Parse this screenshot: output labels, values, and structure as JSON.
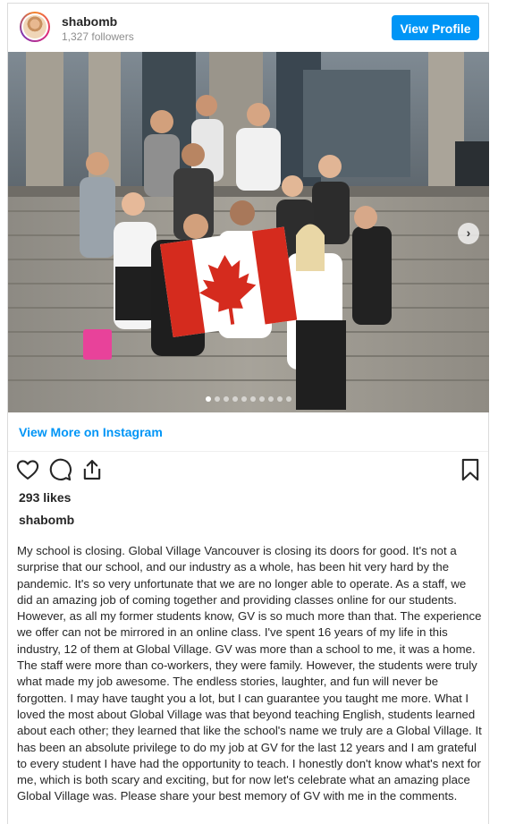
{
  "post": {
    "username": "shabomb",
    "followers": "1,327 followers",
    "view_profile_label": "View Profile",
    "view_more_label": "View More on Instagram",
    "likes": "293 likes",
    "caption_user": "shabomb",
    "caption": "My school is closing. Global Village Vancouver is closing its doors for good. It's not a surprise that our school, and our industry as a whole, has been hit very hard by the pandemic. It's so very unfortunate that we are no longer able to operate. As a staff, we did an amazing job of coming together and providing classes online for our students. However, as all my former students know, GV is so much more than that. The experience we offer can not be mirrored in an online class. I've spent 16 years of my life in this industry, 12 of them at Global Village. GV was more than a school to me, it was a home. The staff were more than co-workers, they were family. However, the students were truly what made my job awesome. The endless stories, laughter, and fun will never be forgotten. I may have taught you a lot, but I can guarantee you taught me more. What I loved the most about Global Village was that beyond teaching English, students learned about each other; they learned that like the school's name we truly are a Global Village. It has been an absolute privilege to do my job at GV for the last 12 years and I am grateful to every student I have had the opportunity to teach. I honestly don't know what's next for me, which is both scary and exciting, but for now let's celebrate what an amazing place Global Village was. Please share your best memory of GV with me in the comments.",
    "carousel": {
      "total_slides": 10,
      "active_slide": 1
    }
  },
  "icons": {
    "like": "heart-icon",
    "comment": "comment-icon",
    "share": "share-icon",
    "save": "bookmark-icon",
    "next": "chevron-right-icon"
  },
  "colors": {
    "accent": "#0095f6",
    "text": "#262626",
    "muted": "#8e8e8e",
    "border": "#dbdbdb"
  }
}
